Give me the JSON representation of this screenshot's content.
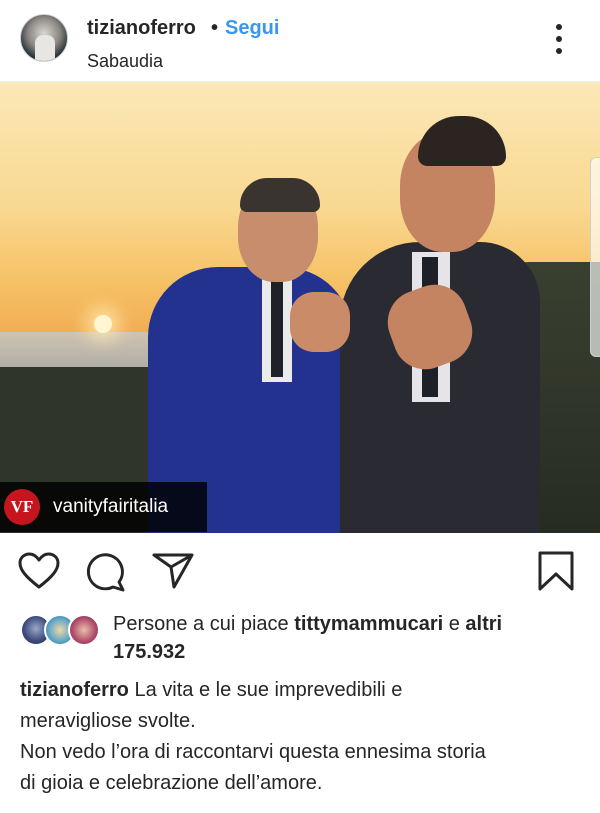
{
  "header": {
    "username": "tizianoferro",
    "separator": "•",
    "follow_label": "Segui",
    "location": "Sabaudia"
  },
  "photo": {
    "tag_username": "vanityfairitalia",
    "tag_logo_text": "VF"
  },
  "actions": {
    "icons": [
      "heart-icon",
      "comment-icon",
      "share-icon",
      "bookmark-icon"
    ]
  },
  "likes": {
    "prefix": "Persone a cui piace ",
    "user": "tittymammucari",
    "middle": " e ",
    "others_label": "altri",
    "count": "175.932"
  },
  "caption": {
    "username": "tizianoferro",
    "line1": " La vita e le sue imprevedibili e",
    "line2": "meravigliose svolte.",
    "line3": "Non vedo l’ora di raccontarvi questa ennesima storia",
    "line4": "di gioia e celebrazione dell’amore.",
    "line5": "—-"
  },
  "colors": {
    "link_blue": "#3897f0",
    "text": "#262626",
    "vf_red": "#c4161c"
  }
}
